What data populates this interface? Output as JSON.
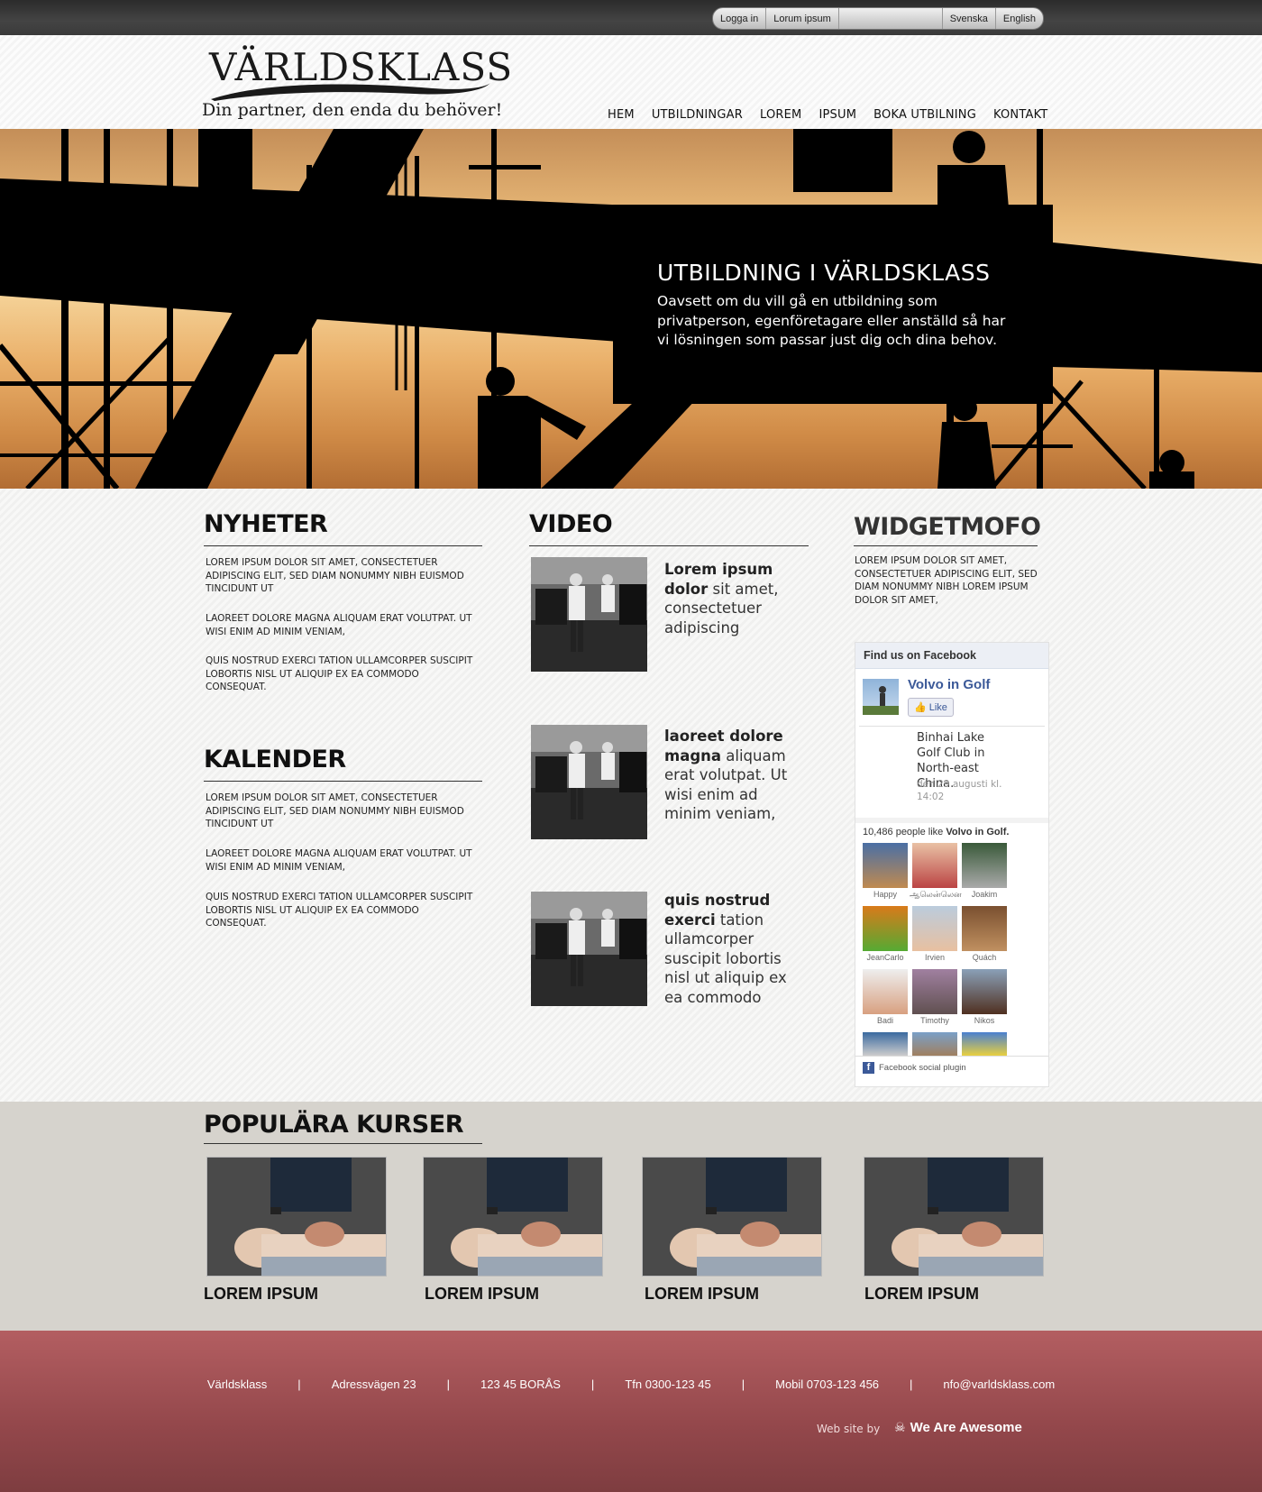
{
  "util": {
    "login": "Logga in",
    "lorum": "Lorum ipsum",
    "search_placeholder": "",
    "lang_sv": "Svenska",
    "lang_en": "English"
  },
  "brand": {
    "title": "VÄRLDSKLASS",
    "tagline": "Din partner, den enda du behöver!"
  },
  "nav": [
    "HEM",
    "UTBILDNINGAR",
    "LOREM",
    "IPSUM",
    "BOKA UTBILNING",
    "KONTAKT"
  ],
  "hero": {
    "title": "UTBILDNING I VÄRLDSKLASS",
    "text": "Oavsett om du vill gå en utbildning som privatperson, egenföretagare eller anställd så har vi lösningen som passar just dig och dina behov."
  },
  "news": {
    "title": "NYHETER",
    "paragraphs": [
      "LOREM IPSUM DOLOR SIT AMET, CONSECTETUER ADIPISCING ELIT, SED DIAM NONUMMY NIBH EUISMOD TINCIDUNT UT",
      "LAOREET DOLORE MAGNA ALIQUAM ERAT VOLUTPAT. UT WISI ENIM AD MINIM VENIAM,",
      "QUIS NOSTRUD EXERCI TATION ULLAMCORPER SUSCIPIT LOBORTIS NISL UT ALIQUIP EX EA COMMODO CONSEQUAT."
    ]
  },
  "calendar": {
    "title": "KALENDER",
    "paragraphs": [
      "LOREM IPSUM DOLOR SIT AMET, CONSECTETUER ADIPISCING ELIT, SED DIAM NONUMMY NIBH EUISMOD TINCIDUNT UT",
      "LAOREET DOLORE MAGNA ALIQUAM ERAT VOLUTPAT. UT WISI ENIM AD MINIM VENIAM,",
      "QUIS NOSTRUD EXERCI TATION ULLAMCORPER SUSCIPIT LOBORTIS NISL UT ALIQUIP EX EA COMMODO CONSEQUAT."
    ]
  },
  "video": {
    "title": "VIDEO",
    "items": [
      {
        "bold": "Lorem ipsum dolor",
        "rest": " sit amet, consectetuer adipiscing"
      },
      {
        "bold": "laoreet dolore magna",
        "rest": " aliquam erat volutpat. Ut wisi enim ad minim veniam,"
      },
      {
        "bold": "quis nostrud exerci",
        "rest": " tation ullamcorper suscipit lobortis nisl ut aliquip ex ea commodo"
      }
    ]
  },
  "widget": {
    "title": "WIDGETMOFO",
    "text": "LOREM IPSUM DOLOR SIT AMET, CONSECTETUER ADIPISCING ELIT, SED DIAM NONUMMY NIBH LOREM IPSUM DOLOR SIT AMET,"
  },
  "facebook": {
    "header": "Find us on Facebook",
    "page_name": "Volvo in Golf",
    "like": "Like",
    "post": "Binhai Lake Golf Club in North-east China.",
    "post_date": "den 29 augusti kl. 14:02",
    "likes_count": "10,486 people like",
    "likes_page": "Volvo in Golf.",
    "fans": [
      "Happy",
      "ஆலென்லென",
      "Joakim",
      "JeanCarlo",
      "Irvien",
      "Quách",
      "Badi",
      "Timothy",
      "Nikos"
    ],
    "plugin": "Facebook social plugin",
    "colors": {
      "link": "#3b5998",
      "header_bg": "#eceff5"
    }
  },
  "popular": {
    "title": "POPULÄRA KURSER",
    "courses": [
      "LOREM IPSUM",
      "LOREM IPSUM",
      "LOREM IPSUM",
      "LOREM IPSUM"
    ]
  },
  "footer": {
    "items": [
      "Världsklass",
      "Adressvägen  23",
      "123 45 BORÅS",
      "Tfn 0300-123 45",
      "Mobil 0703-123 456",
      "nfo@varldsklass.com"
    ],
    "separator": "|",
    "credit_prefix": "Web site by",
    "credit_name": "We Are Awesome"
  },
  "colors": {
    "footer": "#a3515a",
    "popular_bg": "#d6d3cd",
    "topbar": "#333333"
  }
}
